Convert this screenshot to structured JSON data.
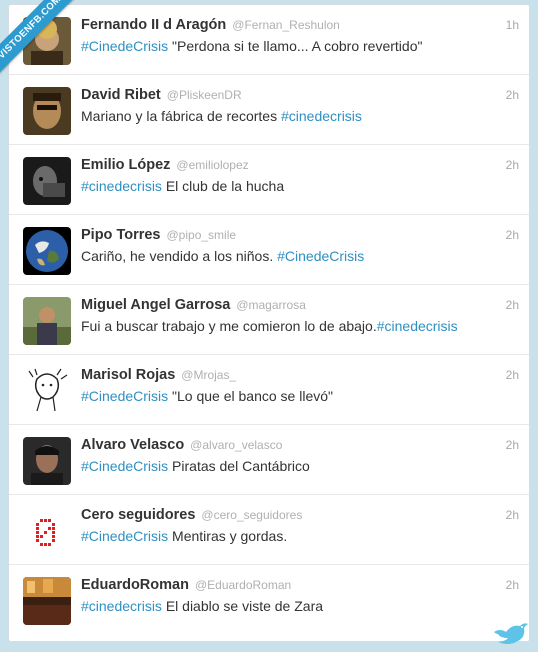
{
  "watermark": "VISTOENFB.COM",
  "tweets": [
    {
      "name": "Fernando II d Aragón",
      "handle": "@Fernan_Reshulon",
      "time": "1h",
      "before": "",
      "hashtag": "#CinedeCrisis",
      "after": " \"Perdona si te llamo... A cobro revertido\""
    },
    {
      "name": "David Ribet",
      "handle": "@PliskeenDR",
      "time": "2h",
      "before": "Mariano y la fábrica de recortes ",
      "hashtag": "#cinedecrisis",
      "after": ""
    },
    {
      "name": "Emilio López",
      "handle": "@emiliolopez",
      "time": "2h",
      "before": "",
      "hashtag": "#cinedecrisis",
      "after": " El club de la hucha"
    },
    {
      "name": "Pipo Torres",
      "handle": "@pipo_smile",
      "time": "2h",
      "before": "Cariño, he vendido a los niños. ",
      "hashtag": "#CinedeCrisis",
      "after": ""
    },
    {
      "name": "Miguel Angel Garrosa",
      "handle": "@magarrosa",
      "time": "2h",
      "before": "Fui a buscar trabajo y me comieron lo de abajo.",
      "hashtag": "#cinedecrisis",
      "after": ""
    },
    {
      "name": "Marisol Rojas",
      "handle": "@Mrojas_",
      "time": "2h",
      "before": "",
      "hashtag": "#CinedeCrisis",
      "after": " \"Lo que el banco se llevó\""
    },
    {
      "name": "Alvaro Velasco",
      "handle": "@alvaro_velasco",
      "time": "2h",
      "before": "",
      "hashtag": "#CinedeCrisis",
      "after": " Piratas del Cantábrico"
    },
    {
      "name": "Cero seguidores",
      "handle": "@cero_seguidores",
      "time": "2h",
      "before": "",
      "hashtag": "#CinedeCrisis",
      "after": " Mentiras y gordas."
    },
    {
      "name": "EduardoRoman",
      "handle": "@EduardoRoman",
      "time": "2h",
      "before": "",
      "hashtag": "#cinedecrisis",
      "after": " El diablo se viste de Zara"
    }
  ]
}
